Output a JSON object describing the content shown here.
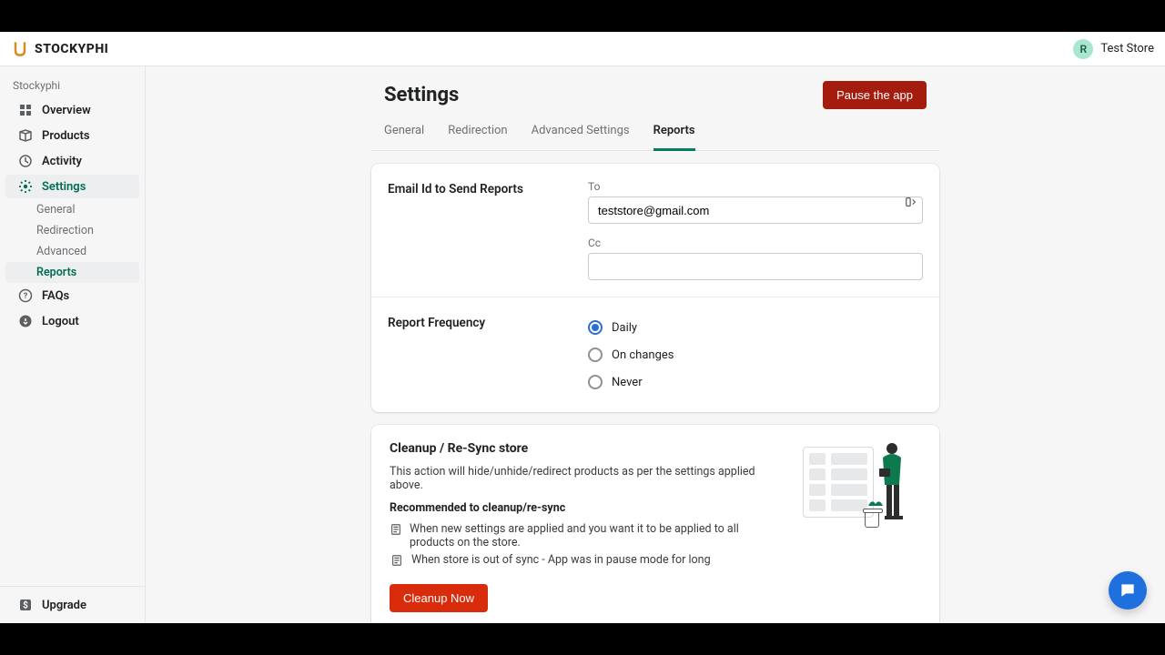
{
  "brand": {
    "name": "STOCKYPHI"
  },
  "store": {
    "initial": "R",
    "name": "Test Store"
  },
  "sidebar": {
    "heading": "Stockyphi",
    "items": [
      {
        "label": "Overview"
      },
      {
        "label": "Products"
      },
      {
        "label": "Activity"
      },
      {
        "label": "Settings"
      },
      {
        "label": "FAQs"
      },
      {
        "label": "Logout"
      }
    ],
    "settings_sub": [
      {
        "label": "General"
      },
      {
        "label": "Redirection"
      },
      {
        "label": "Advanced"
      },
      {
        "label": "Reports"
      }
    ],
    "footer": {
      "upgrade": "Upgrade"
    }
  },
  "page": {
    "title": "Settings",
    "pause_button": "Pause the app"
  },
  "tabs": [
    {
      "label": "General"
    },
    {
      "label": "Redirection"
    },
    {
      "label": "Advanced Settings"
    },
    {
      "label": "Reports"
    }
  ],
  "email_section": {
    "heading": "Email Id to Send Reports",
    "to_label": "To",
    "to_value": "teststore@gmail.com",
    "cc_label": "Cc",
    "cc_value": ""
  },
  "frequency_section": {
    "heading": "Report Frequency",
    "options": [
      {
        "label": "Daily"
      },
      {
        "label": "On changes"
      },
      {
        "label": "Never"
      }
    ],
    "selected": 0
  },
  "cleanup": {
    "heading": "Cleanup / Re-Sync store",
    "desc": "This action will hide/unhide/redirect products as per the settings applied above.",
    "recommend": "Recommended to cleanup/re-sync",
    "bullets": [
      "When new settings are applied and you want it to be applied to all products on the store.",
      "When store is out of sync - App was in pause mode for long"
    ],
    "button": "Cleanup Now"
  }
}
